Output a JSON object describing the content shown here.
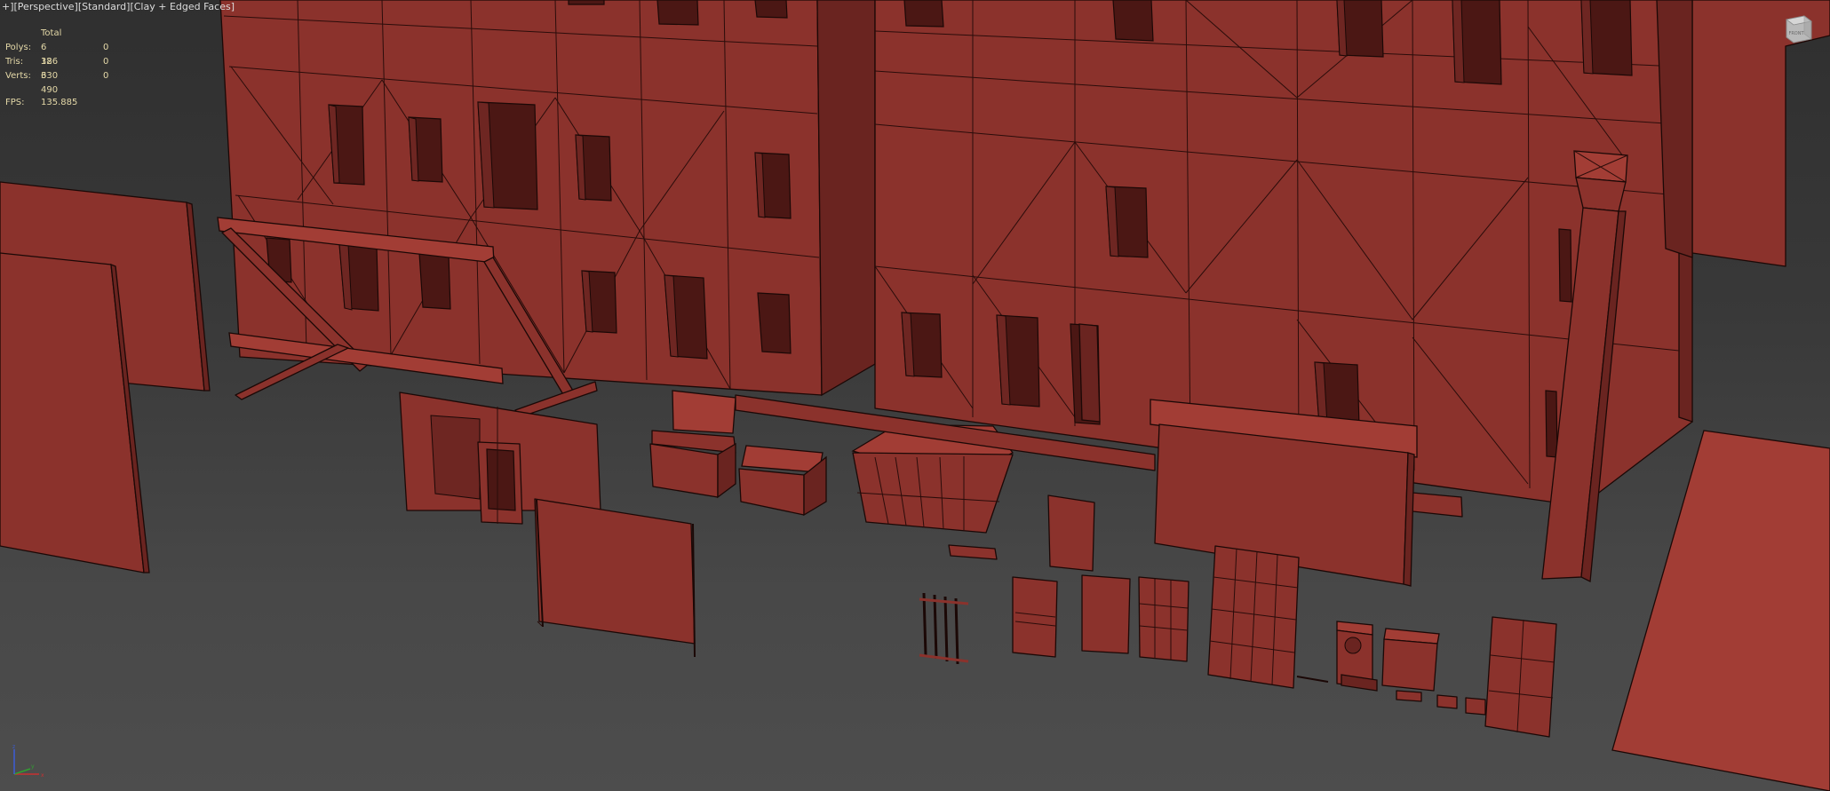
{
  "viewport": {
    "label_segments": [
      "+",
      "]",
      "[Perspective",
      "]",
      "[Standard",
      "]",
      "[Clay + Edged Faces",
      "]"
    ]
  },
  "stats": {
    "header": "Total",
    "rows": [
      {
        "label": "Polys:",
        "total": "6 386",
        "selected": "0"
      },
      {
        "label": "Tris:",
        "total": "12 330",
        "selected": "0"
      },
      {
        "label": "Verts:",
        "total": "6 490",
        "selected": "0"
      }
    ],
    "fps_label": "FPS:",
    "fps_value": "135.885"
  },
  "viewcube": {
    "face_label": "FRONT"
  },
  "axis_tripod": {
    "x": "x",
    "y": "y",
    "z": "z"
  },
  "colors": {
    "viewport_top": "#2f2f2f",
    "viewport_bottom": "#4d4d4d",
    "clay": "#8b322c",
    "edge": "#1b0806",
    "stats_text": "#e5d9a8"
  }
}
